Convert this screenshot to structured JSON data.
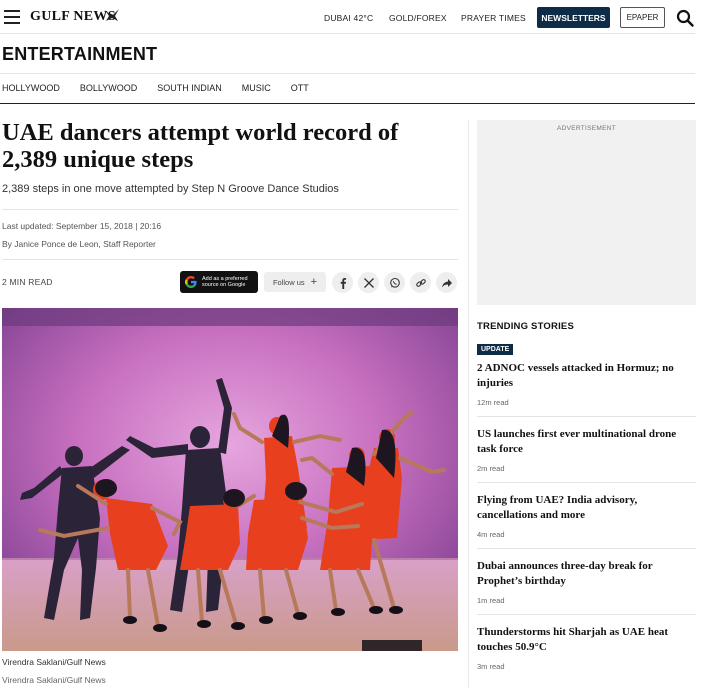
{
  "header": {
    "logo_text": "GULF NEWS",
    "links": [
      "DUBAI 42°C",
      "GOLD/FOREX",
      "PRAYER TIMES"
    ],
    "newsletters_label": "NEWSLETTERS",
    "epaper_label": "EPAPER"
  },
  "section": {
    "title": "ENTERTAINMENT",
    "subnav": [
      "HOLLYWOOD",
      "BOLLYWOOD",
      "SOUTH INDIAN",
      "MUSIC",
      "OTT"
    ]
  },
  "article": {
    "headline": "UAE dancers attempt world record of 2,389 unique steps",
    "dek": "2,389 steps in one move attempted by Step N Groove Dance Studios",
    "updated": "Last updated: September 15, 2018 | 20:16",
    "byline": "By Janice Ponce de Leon, Staff Reporter",
    "read_time": "2 MIN READ",
    "google_badge": "Add as a preferred source on Google",
    "follow_label": "Follow us",
    "caption": "Virendra Saklani/Gulf News",
    "credit": "Virendra Saklani/Gulf News"
  },
  "sidebar": {
    "ad_label": "ADVERTISEMENT",
    "trending_title": "TRENDING STORIES",
    "update_badge": "UPDATE",
    "stories": [
      {
        "title": "2 ADNOC vessels attacked in Hormuz; no injuries",
        "time": "12m read"
      },
      {
        "title": "US launches first ever multinational drone task force",
        "time": "2m read"
      },
      {
        "title": "Flying from UAE? India advisory, cancellations and more",
        "time": "4m read"
      },
      {
        "title": "Dubai announces three-day break for Prophet’s birthday",
        "time": "1m read"
      },
      {
        "title": "Thunderstorms hit Sharjah as UAE heat touches 50.9°C",
        "time": "3m read"
      }
    ]
  },
  "colors": {
    "brand_navy": "#0e2c48",
    "dress_red": "#e8401e"
  }
}
